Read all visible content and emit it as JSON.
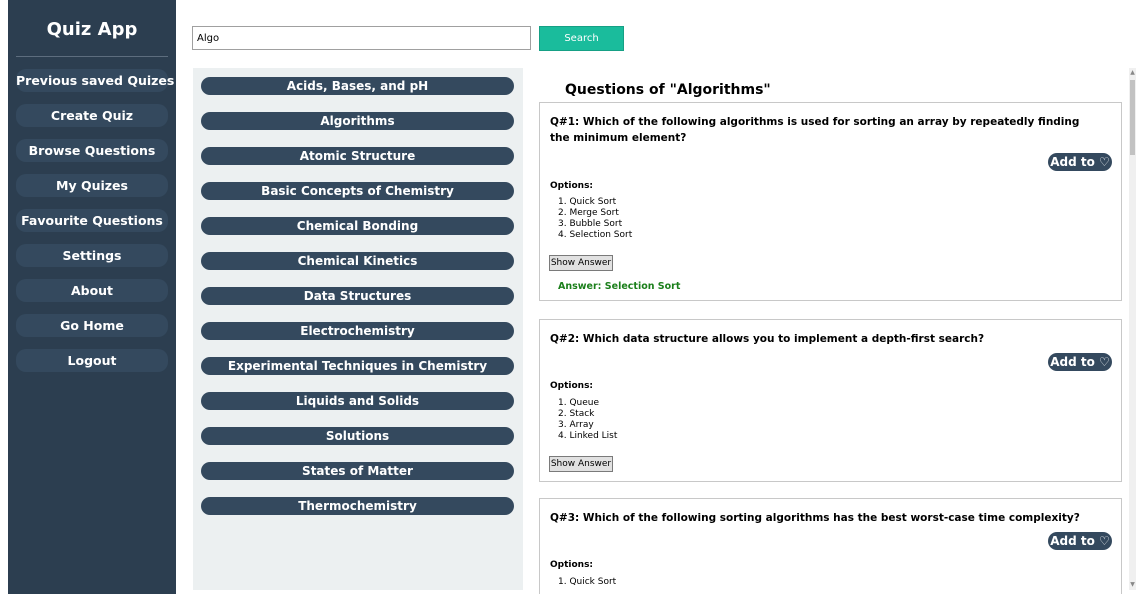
{
  "sidebar": {
    "title": "Quiz App",
    "items": [
      {
        "label": "Previous saved Quizes"
      },
      {
        "label": "Create Quiz"
      },
      {
        "label": "Browse Questions"
      },
      {
        "label": "My Quizes"
      },
      {
        "label": "Favourite Questions"
      },
      {
        "label": "Settings"
      },
      {
        "label": "About"
      },
      {
        "label": "Go Home"
      },
      {
        "label": "Logout"
      }
    ]
  },
  "search": {
    "value": "Algo",
    "button_label": "Search"
  },
  "topics": [
    "Acids, Bases, and pH",
    "Algorithms",
    "Atomic Structure",
    "Basic Concepts of Chemistry",
    "Chemical Bonding",
    "Chemical Kinetics",
    "Data Structures",
    "Electrochemistry",
    "Experimental Techniques in Chemistry",
    "Liquids and Solids",
    "Solutions",
    "States of Matter",
    "Thermochemistry"
  ],
  "questions_panel": {
    "title": "Questions of \"Algorithms\"",
    "add_label": "Add to ♡",
    "options_label": "Options:",
    "show_answer_label": "Show Answer",
    "questions": [
      {
        "text": "Q#1: Which of the following algorithms is used for sorting an array by repeatedly finding the minimum element?",
        "options": [
          "1. Quick Sort",
          "2. Merge Sort",
          "3. Bubble Sort",
          "4. Selection Sort"
        ],
        "answer": "Answer: Selection Sort"
      },
      {
        "text": "Q#2: Which data structure allows you to implement a depth-first search?",
        "options": [
          "1. Queue",
          "2. Stack",
          "3. Array",
          "4. Linked List"
        ]
      },
      {
        "text": "Q#3: Which of the following sorting algorithms has the best worst-case time complexity?",
        "options": [
          "1. Quick Sort"
        ]
      }
    ]
  },
  "colors": {
    "sidebar_bg": "#2c3e50",
    "pill_bg": "#34495e",
    "accent": "#1abc9c",
    "answer_text": "#1b7f1b",
    "topics_bg": "#ecf0f1"
  }
}
